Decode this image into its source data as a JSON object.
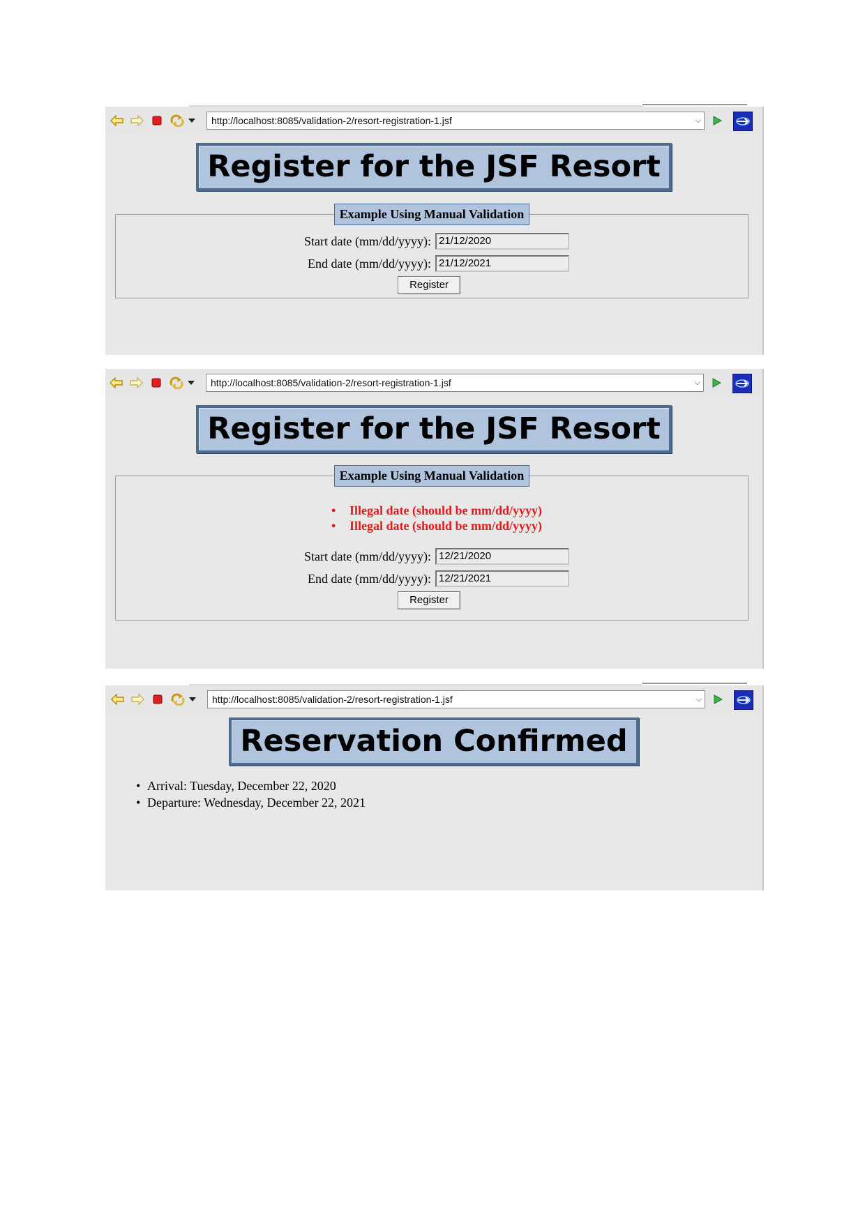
{
  "url": "http://localhost:8085/validation-2/resort-registration-1.jsf",
  "icons": [
    "back-arrow-icon",
    "forward-arrow-icon",
    "stop-icon",
    "refresh-icon",
    "dropdown-arrow-icon",
    "go-icon",
    "browser-logo-icon"
  ],
  "colors": {
    "banner_bg": "#b0c4de",
    "banner_border": "#4d6a8f",
    "error": "#e01b1b",
    "page_bg": "#e8e8e8"
  },
  "screen1": {
    "heading": "Register for the JSF Resort",
    "legend": "Example Using Manual Validation",
    "start_label": "Start date (mm/dd/yyyy):",
    "start_value": "21/12/2020",
    "end_label": "End date (mm/dd/yyyy):",
    "end_value": "21/12/2021",
    "button": "Register"
  },
  "screen2": {
    "heading": "Register for the JSF Resort",
    "legend": "Example Using Manual Validation",
    "errors": [
      "Illegal date (should be mm/dd/yyyy)",
      "Illegal date (should be mm/dd/yyyy)"
    ],
    "start_label": "Start date (mm/dd/yyyy):",
    "start_value": "12/21/2020",
    "end_label": "End date (mm/dd/yyyy):",
    "end_value": "12/21/2021",
    "button": "Register"
  },
  "screen3": {
    "heading": "Reservation Confirmed",
    "arrival_label": "Arrival:",
    "arrival_value": "Tuesday, December 22, 2020",
    "departure_label": "Departure:",
    "departure_value": "Wednesday, December 22, 2021"
  }
}
